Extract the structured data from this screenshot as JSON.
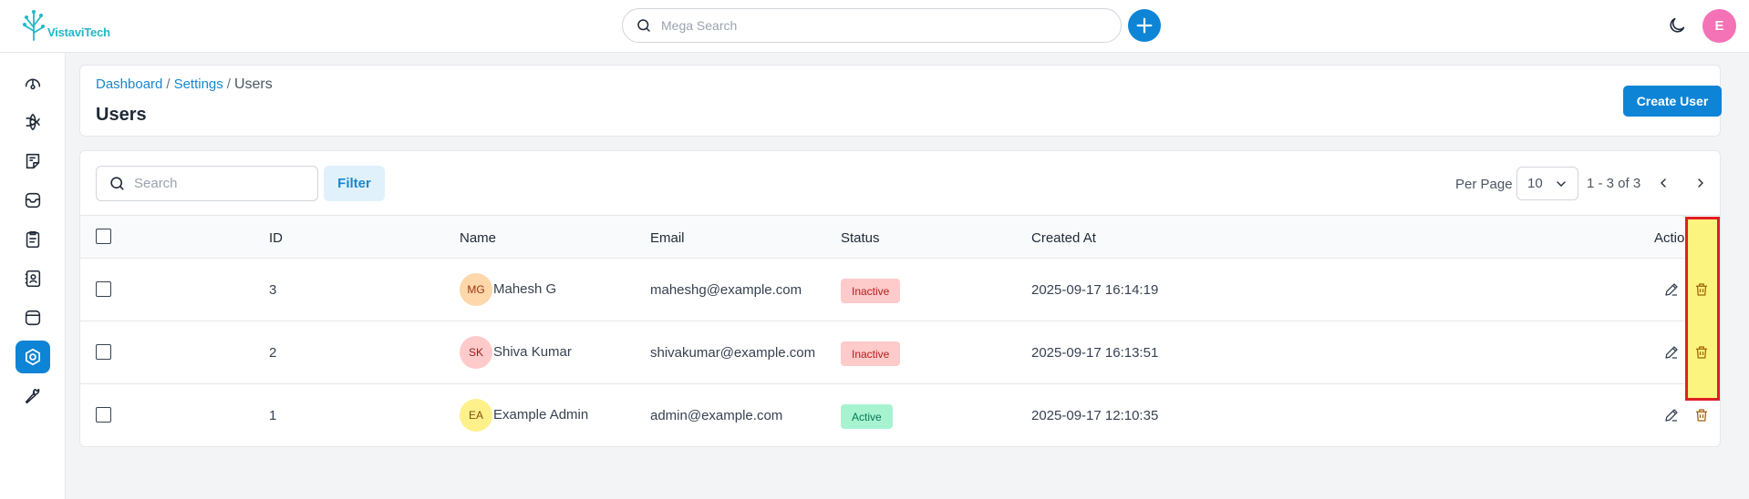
{
  "app": {
    "brand": "VistaviTech",
    "user_initial": "E",
    "accent": "#0e84d6",
    "brand_color": "#22b8c7"
  },
  "topbar": {
    "search_placeholder": "Mega Search"
  },
  "sidebar": {
    "items": [
      {
        "icon": "dashboard-gauge-icon"
      },
      {
        "icon": "ai-network-icon"
      },
      {
        "icon": "notes-icon"
      },
      {
        "icon": "inbox-icon"
      },
      {
        "icon": "clipboard-icon"
      },
      {
        "icon": "contacts-icon"
      },
      {
        "icon": "archive-icon"
      },
      {
        "icon": "settings-icon",
        "active": true
      },
      {
        "icon": "wrench-icon"
      }
    ]
  },
  "header": {
    "breadcrumb": [
      "Dashboard",
      "Settings",
      "Users"
    ],
    "breadcrumb_sep": "/",
    "title": "Users",
    "create_label": "Create User"
  },
  "toolbar": {
    "search_placeholder": "Search",
    "filter_label": "Filter",
    "per_page_label": "Per Page",
    "per_page_value": "10",
    "range": "1 - 3 of 3"
  },
  "table": {
    "columns": [
      "ID",
      "Name",
      "Email",
      "Status",
      "Created At",
      "Actions"
    ],
    "rows": [
      {
        "id": "3",
        "initials": "MG",
        "name": "Mahesh G",
        "email": "maheshg@example.com",
        "status": "Inactive",
        "created": "2025-09-17 16:14:19",
        "avatar_bg": "#fed7aa",
        "avatar_fg": "#9a3412"
      },
      {
        "id": "2",
        "initials": "SK",
        "name": "Shiva Kumar",
        "email": "shivakumar@example.com",
        "status": "Inactive",
        "created": "2025-09-17 16:13:51",
        "avatar_bg": "#fecaca",
        "avatar_fg": "#991b1b"
      },
      {
        "id": "1",
        "initials": "EA",
        "name": "Example Admin",
        "email": "admin@example.com",
        "status": "Active",
        "created": "2025-09-17 12:10:35",
        "avatar_bg": "#fef08a",
        "avatar_fg": "#854d0e"
      }
    ]
  }
}
